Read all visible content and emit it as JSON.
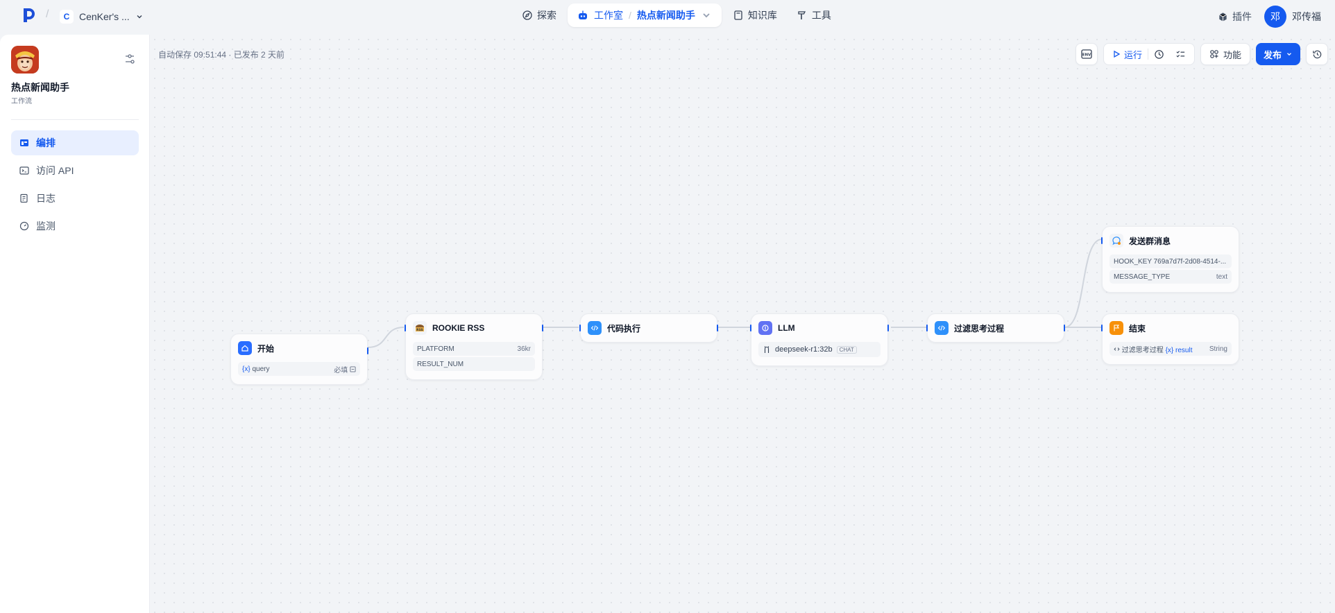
{
  "topnav": {
    "workspace_badge": "C",
    "workspace_name": "CenKer's ...",
    "items": [
      {
        "label": "探索"
      },
      {
        "label": "工作室"
      },
      {
        "label": "知识库"
      },
      {
        "label": "工具"
      }
    ],
    "current_app": "热点新闻助手",
    "plugins_label": "插件",
    "user_initial": "邓",
    "user_name": "邓传福"
  },
  "sidebar": {
    "app_name": "热点新闻助手",
    "app_type": "工作流",
    "items": [
      {
        "label": "编排",
        "icon": "layout-icon",
        "active": true
      },
      {
        "label": "访问 API",
        "icon": "terminal-icon",
        "active": false
      },
      {
        "label": "日志",
        "icon": "log-icon",
        "active": false
      },
      {
        "label": "监测",
        "icon": "gauge-icon",
        "active": false
      }
    ]
  },
  "canvas": {
    "autosave": "自动保存 09:51:44 · 已发布 2 天前",
    "toolbar": {
      "env_label": "ENV",
      "run_label": "运行",
      "features_label": "功能",
      "publish_label": "发布"
    }
  },
  "nodes": {
    "start": {
      "title": "开始",
      "var_prefix": "{x}",
      "var": "query",
      "required": "必填"
    },
    "rss": {
      "title": "ROOKIE RSS",
      "rows": [
        {
          "k": "PLATFORM",
          "v": "36kr"
        },
        {
          "k": "RESULT_NUM",
          "v": ""
        }
      ]
    },
    "code": {
      "title": "代码执行"
    },
    "llm": {
      "title": "LLM",
      "model": "deepseek-r1:32b",
      "mode": "CHAT"
    },
    "filter": {
      "title": "过滤思考过程"
    },
    "send": {
      "title": "发送群消息",
      "rows": [
        {
          "k": "HOOK_KEY",
          "v": "769a7d7f-2d08-4514-..."
        },
        {
          "k": "MESSAGE_TYPE",
          "v": "text"
        }
      ]
    },
    "end": {
      "title": "结束",
      "source": "过滤思考过程",
      "var_prefix": "{x}",
      "var": "result",
      "type": "String"
    }
  },
  "colors": {
    "accent": "#155aef",
    "start_icon": "#296dff",
    "llm_icon": "#6172f3",
    "code_icon": "#2e90fa",
    "end_icon": "#f79009"
  }
}
